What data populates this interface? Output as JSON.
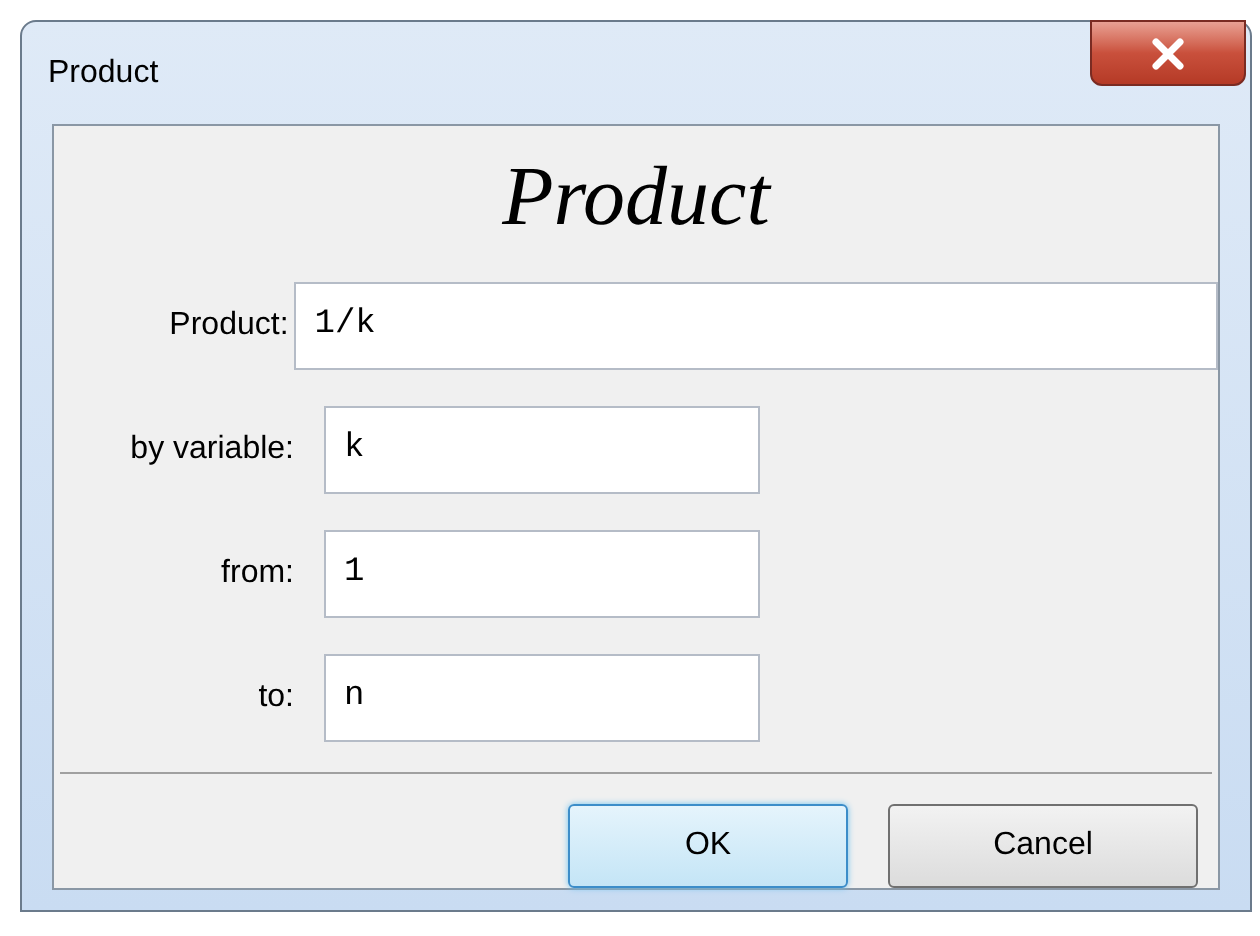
{
  "window": {
    "title": "Product"
  },
  "heading": "Product",
  "fields": [
    {
      "label": "Product:",
      "value": "1/k",
      "kind": "long"
    },
    {
      "label": "by variable:",
      "value": "k",
      "kind": "short"
    },
    {
      "label": "from:",
      "value": "1",
      "kind": "short"
    },
    {
      "label": "to:",
      "value": "n",
      "kind": "short"
    }
  ],
  "buttons": [
    {
      "label": "OK",
      "default": true
    },
    {
      "label": "Cancel",
      "default": false
    }
  ]
}
